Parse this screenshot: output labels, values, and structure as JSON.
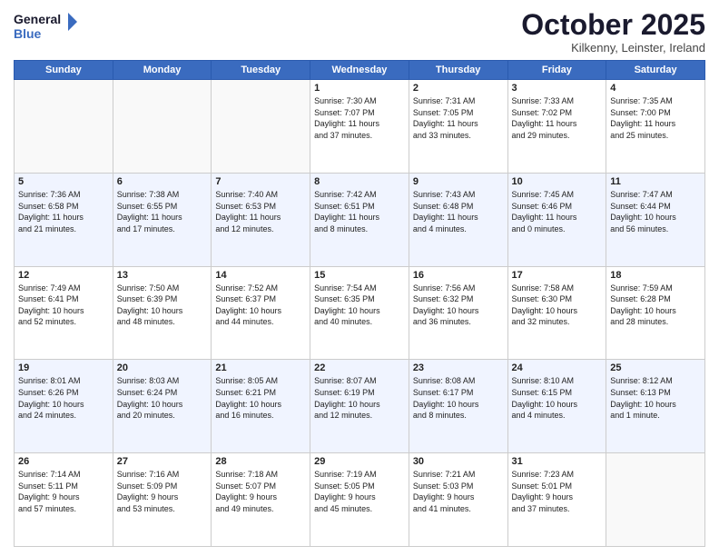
{
  "logo": {
    "line1": "General",
    "line2": "Blue"
  },
  "title": "October 2025",
  "subtitle": "Kilkenny, Leinster, Ireland",
  "weekdays": [
    "Sunday",
    "Monday",
    "Tuesday",
    "Wednesday",
    "Thursday",
    "Friday",
    "Saturday"
  ],
  "weeks": [
    [
      {
        "day": "",
        "info": ""
      },
      {
        "day": "",
        "info": ""
      },
      {
        "day": "",
        "info": ""
      },
      {
        "day": "1",
        "info": "Sunrise: 7:30 AM\nSunset: 7:07 PM\nDaylight: 11 hours\nand 37 minutes."
      },
      {
        "day": "2",
        "info": "Sunrise: 7:31 AM\nSunset: 7:05 PM\nDaylight: 11 hours\nand 33 minutes."
      },
      {
        "day": "3",
        "info": "Sunrise: 7:33 AM\nSunset: 7:02 PM\nDaylight: 11 hours\nand 29 minutes."
      },
      {
        "day": "4",
        "info": "Sunrise: 7:35 AM\nSunset: 7:00 PM\nDaylight: 11 hours\nand 25 minutes."
      }
    ],
    [
      {
        "day": "5",
        "info": "Sunrise: 7:36 AM\nSunset: 6:58 PM\nDaylight: 11 hours\nand 21 minutes."
      },
      {
        "day": "6",
        "info": "Sunrise: 7:38 AM\nSunset: 6:55 PM\nDaylight: 11 hours\nand 17 minutes."
      },
      {
        "day": "7",
        "info": "Sunrise: 7:40 AM\nSunset: 6:53 PM\nDaylight: 11 hours\nand 12 minutes."
      },
      {
        "day": "8",
        "info": "Sunrise: 7:42 AM\nSunset: 6:51 PM\nDaylight: 11 hours\nand 8 minutes."
      },
      {
        "day": "9",
        "info": "Sunrise: 7:43 AM\nSunset: 6:48 PM\nDaylight: 11 hours\nand 4 minutes."
      },
      {
        "day": "10",
        "info": "Sunrise: 7:45 AM\nSunset: 6:46 PM\nDaylight: 11 hours\nand 0 minutes."
      },
      {
        "day": "11",
        "info": "Sunrise: 7:47 AM\nSunset: 6:44 PM\nDaylight: 10 hours\nand 56 minutes."
      }
    ],
    [
      {
        "day": "12",
        "info": "Sunrise: 7:49 AM\nSunset: 6:41 PM\nDaylight: 10 hours\nand 52 minutes."
      },
      {
        "day": "13",
        "info": "Sunrise: 7:50 AM\nSunset: 6:39 PM\nDaylight: 10 hours\nand 48 minutes."
      },
      {
        "day": "14",
        "info": "Sunrise: 7:52 AM\nSunset: 6:37 PM\nDaylight: 10 hours\nand 44 minutes."
      },
      {
        "day": "15",
        "info": "Sunrise: 7:54 AM\nSunset: 6:35 PM\nDaylight: 10 hours\nand 40 minutes."
      },
      {
        "day": "16",
        "info": "Sunrise: 7:56 AM\nSunset: 6:32 PM\nDaylight: 10 hours\nand 36 minutes."
      },
      {
        "day": "17",
        "info": "Sunrise: 7:58 AM\nSunset: 6:30 PM\nDaylight: 10 hours\nand 32 minutes."
      },
      {
        "day": "18",
        "info": "Sunrise: 7:59 AM\nSunset: 6:28 PM\nDaylight: 10 hours\nand 28 minutes."
      }
    ],
    [
      {
        "day": "19",
        "info": "Sunrise: 8:01 AM\nSunset: 6:26 PM\nDaylight: 10 hours\nand 24 minutes."
      },
      {
        "day": "20",
        "info": "Sunrise: 8:03 AM\nSunset: 6:24 PM\nDaylight: 10 hours\nand 20 minutes."
      },
      {
        "day": "21",
        "info": "Sunrise: 8:05 AM\nSunset: 6:21 PM\nDaylight: 10 hours\nand 16 minutes."
      },
      {
        "day": "22",
        "info": "Sunrise: 8:07 AM\nSunset: 6:19 PM\nDaylight: 10 hours\nand 12 minutes."
      },
      {
        "day": "23",
        "info": "Sunrise: 8:08 AM\nSunset: 6:17 PM\nDaylight: 10 hours\nand 8 minutes."
      },
      {
        "day": "24",
        "info": "Sunrise: 8:10 AM\nSunset: 6:15 PM\nDaylight: 10 hours\nand 4 minutes."
      },
      {
        "day": "25",
        "info": "Sunrise: 8:12 AM\nSunset: 6:13 PM\nDaylight: 10 hours\nand 1 minute."
      }
    ],
    [
      {
        "day": "26",
        "info": "Sunrise: 7:14 AM\nSunset: 5:11 PM\nDaylight: 9 hours\nand 57 minutes."
      },
      {
        "day": "27",
        "info": "Sunrise: 7:16 AM\nSunset: 5:09 PM\nDaylight: 9 hours\nand 53 minutes."
      },
      {
        "day": "28",
        "info": "Sunrise: 7:18 AM\nSunset: 5:07 PM\nDaylight: 9 hours\nand 49 minutes."
      },
      {
        "day": "29",
        "info": "Sunrise: 7:19 AM\nSunset: 5:05 PM\nDaylight: 9 hours\nand 45 minutes."
      },
      {
        "day": "30",
        "info": "Sunrise: 7:21 AM\nSunset: 5:03 PM\nDaylight: 9 hours\nand 41 minutes."
      },
      {
        "day": "31",
        "info": "Sunrise: 7:23 AM\nSunset: 5:01 PM\nDaylight: 9 hours\nand 37 minutes."
      },
      {
        "day": "",
        "info": ""
      }
    ]
  ]
}
